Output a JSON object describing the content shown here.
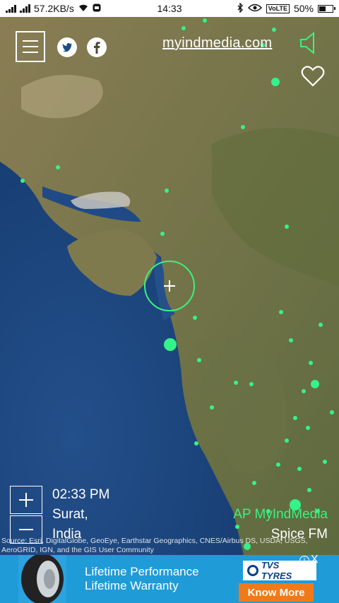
{
  "status_bar": {
    "speed": "57.2KB/s",
    "time": "14:33",
    "network_badge": "VoLTE",
    "battery": "50%"
  },
  "header": {
    "brand_link": "myindmedia.com",
    "icons": [
      "menu-icon",
      "twitter-icon",
      "facebook-icon",
      "speaker-icon",
      "heart-icon"
    ]
  },
  "map": {
    "crosshair_marker": "crosshair-icon",
    "colors": {
      "ocean": "#1d4b86",
      "land": "#746e49",
      "station_dot": "#35f28a"
    }
  },
  "location": {
    "time": "02:33 PM",
    "city": "Surat,",
    "country": "India"
  },
  "stations": {
    "primary": "AP MyIndMedia",
    "secondary": "Spice FM"
  },
  "attribution": "Source: Esri, DigitalGlobe, GeoEye, Earthstar Geographics, CNES/Airbus DS, USDA, USGS, AeroGRID, IGN, and the GIS User Community",
  "ad": {
    "line1": "Lifetime Performance",
    "line2": "Lifetime Warranty",
    "brand": "TVS TYRES",
    "cta": "Know More",
    "info": "i",
    "close": "X"
  }
}
